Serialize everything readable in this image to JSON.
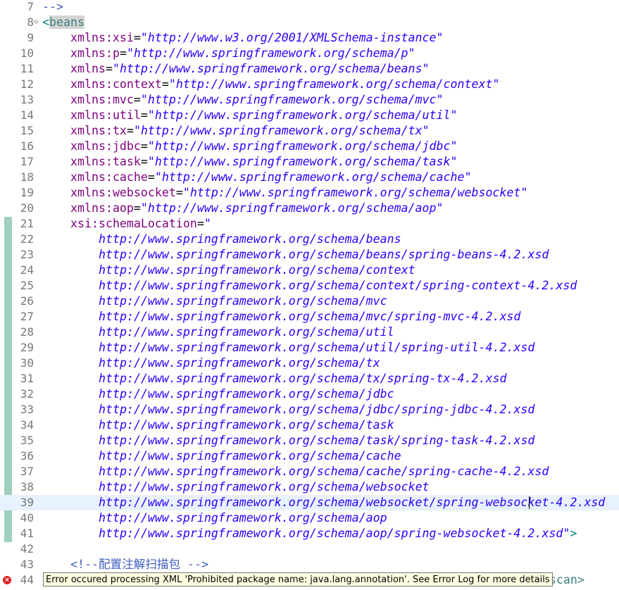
{
  "editor": {
    "lines": [
      {
        "num": "7",
        "parts": [
          {
            "t": "-->",
            "c": "comment"
          }
        ]
      },
      {
        "num": "8",
        "fold": "⊖",
        "parts": [
          {
            "t": "<",
            "c": "punct"
          },
          {
            "t": "beans",
            "c": "tag hl"
          }
        ]
      },
      {
        "num": "9",
        "indent": 1,
        "parts": [
          {
            "t": "xmlns:xsi",
            "c": "attr"
          },
          {
            "t": "=",
            "c": "plain"
          },
          {
            "t": "\"http://www.w3.org/2001/XMLSchema-instance\"",
            "c": "val"
          }
        ]
      },
      {
        "num": "10",
        "indent": 1,
        "parts": [
          {
            "t": "xmlns:p",
            "c": "attr"
          },
          {
            "t": "=",
            "c": "plain"
          },
          {
            "t": "\"http://www.springframework.org/schema/p\"",
            "c": "val"
          }
        ]
      },
      {
        "num": "11",
        "indent": 1,
        "parts": [
          {
            "t": "xmlns",
            "c": "attr"
          },
          {
            "t": "=",
            "c": "plain"
          },
          {
            "t": "\"http://www.springframework.org/schema/beans\"",
            "c": "val"
          }
        ]
      },
      {
        "num": "12",
        "indent": 1,
        "parts": [
          {
            "t": "xmlns:context",
            "c": "attr"
          },
          {
            "t": "=",
            "c": "plain"
          },
          {
            "t": "\"http://www.springframework.org/schema/context\"",
            "c": "val"
          }
        ]
      },
      {
        "num": "13",
        "indent": 1,
        "parts": [
          {
            "t": "xmlns:mvc",
            "c": "attr"
          },
          {
            "t": "=",
            "c": "plain"
          },
          {
            "t": "\"http://www.springframework.org/schema/mvc\"",
            "c": "val"
          }
        ]
      },
      {
        "num": "14",
        "indent": 1,
        "parts": [
          {
            "t": "xmlns:util",
            "c": "attr"
          },
          {
            "t": "=",
            "c": "plain"
          },
          {
            "t": "\"http://www.springframework.org/schema/util\"",
            "c": "val"
          }
        ]
      },
      {
        "num": "15",
        "indent": 1,
        "parts": [
          {
            "t": "xmlns:tx",
            "c": "attr"
          },
          {
            "t": "=",
            "c": "plain"
          },
          {
            "t": "\"http://www.springframework.org/schema/tx\"",
            "c": "val"
          }
        ]
      },
      {
        "num": "16",
        "indent": 1,
        "parts": [
          {
            "t": "xmlns:jdbc",
            "c": "attr"
          },
          {
            "t": "=",
            "c": "plain"
          },
          {
            "t": "\"http://www.springframework.org/schema/jdbc\"",
            "c": "val"
          }
        ]
      },
      {
        "num": "17",
        "indent": 1,
        "parts": [
          {
            "t": "xmlns:task",
            "c": "attr"
          },
          {
            "t": "=",
            "c": "plain"
          },
          {
            "t": "\"http://www.springframework.org/schema/task\"",
            "c": "val"
          }
        ]
      },
      {
        "num": "18",
        "indent": 1,
        "parts": [
          {
            "t": "xmlns:cache",
            "c": "attr"
          },
          {
            "t": "=",
            "c": "plain"
          },
          {
            "t": "\"http://www.springframework.org/schema/cache\"",
            "c": "val"
          }
        ]
      },
      {
        "num": "19",
        "indent": 1,
        "parts": [
          {
            "t": "xmlns:websocket",
            "c": "attr"
          },
          {
            "t": "=",
            "c": "plain"
          },
          {
            "t": "\"http://www.springframework.org/schema/websocket\"",
            "c": "val"
          }
        ]
      },
      {
        "num": "20",
        "indent": 1,
        "parts": [
          {
            "t": "xmlns:aop",
            "c": "attr"
          },
          {
            "t": "=",
            "c": "plain"
          },
          {
            "t": "\"http://www.springframework.org/schema/aop\"",
            "c": "val"
          }
        ]
      },
      {
        "num": "21",
        "indent": 1,
        "parts": [
          {
            "t": "xsi:schemaLocation",
            "c": "attr"
          },
          {
            "t": "=",
            "c": "plain"
          },
          {
            "t": "\"",
            "c": "val"
          }
        ]
      },
      {
        "num": "22",
        "indent": 2,
        "parts": [
          {
            "t": "http://www.springframework.org/schema/beans",
            "c": "val"
          }
        ]
      },
      {
        "num": "23",
        "indent": 2,
        "parts": [
          {
            "t": "http://www.springframework.org/schema/beans/spring-beans-4.2.xsd",
            "c": "val"
          }
        ]
      },
      {
        "num": "24",
        "indent": 2,
        "parts": [
          {
            "t": "http://www.springframework.org/schema/context",
            "c": "val"
          }
        ]
      },
      {
        "num": "25",
        "indent": 2,
        "parts": [
          {
            "t": "http://www.springframework.org/schema/context/spring-context-4.2.xsd",
            "c": "val"
          }
        ]
      },
      {
        "num": "26",
        "indent": 2,
        "parts": [
          {
            "t": "http://www.springframework.org/schema/mvc",
            "c": "val"
          }
        ]
      },
      {
        "num": "27",
        "indent": 2,
        "parts": [
          {
            "t": "http://www.springframework.org/schema/mvc/spring-mvc-4.2.xsd",
            "c": "val"
          }
        ]
      },
      {
        "num": "28",
        "indent": 2,
        "parts": [
          {
            "t": "http://www.springframework.org/schema/util",
            "c": "val"
          }
        ]
      },
      {
        "num": "29",
        "indent": 2,
        "parts": [
          {
            "t": "http://www.springframework.org/schema/util/spring-util-4.2.xsd",
            "c": "val"
          }
        ]
      },
      {
        "num": "30",
        "indent": 2,
        "parts": [
          {
            "t": "http://www.springframework.org/schema/tx",
            "c": "val"
          }
        ]
      },
      {
        "num": "31",
        "indent": 2,
        "parts": [
          {
            "t": "http://www.springframework.org/schema/tx/spring-tx-4.2.xsd",
            "c": "val"
          }
        ]
      },
      {
        "num": "32",
        "indent": 2,
        "parts": [
          {
            "t": "http://www.springframework.org/schema/jdbc",
            "c": "val"
          }
        ]
      },
      {
        "num": "33",
        "indent": 2,
        "parts": [
          {
            "t": "http://www.springframework.org/schema/jdbc/spring-jdbc-4.2.xsd",
            "c": "val"
          }
        ]
      },
      {
        "num": "34",
        "indent": 2,
        "parts": [
          {
            "t": "http://www.springframework.org/schema/task",
            "c": "val"
          }
        ]
      },
      {
        "num": "35",
        "indent": 2,
        "parts": [
          {
            "t": "http://www.springframework.org/schema/task/spring-task-4.2.xsd",
            "c": "val"
          }
        ]
      },
      {
        "num": "36",
        "indent": 2,
        "parts": [
          {
            "t": "http://www.springframework.org/schema/cache",
            "c": "val"
          }
        ]
      },
      {
        "num": "37",
        "indent": 2,
        "parts": [
          {
            "t": "http://www.springframework.org/schema/cache/spring-cache-4.2.xsd",
            "c": "val"
          }
        ]
      },
      {
        "num": "38",
        "indent": 2,
        "parts": [
          {
            "t": "http://www.springframework.org/schema/websocket",
            "c": "val"
          }
        ]
      },
      {
        "num": "39",
        "indent": 2,
        "current": true,
        "parts": [
          {
            "t": "http://www.springframework.org/schema/websocket/spring-websocket-4.2.xsd",
            "c": "val"
          }
        ]
      },
      {
        "num": "40",
        "indent": 2,
        "parts": [
          {
            "t": "http://www.springframework.org/schema/aop",
            "c": "val"
          }
        ]
      },
      {
        "num": "41",
        "indent": 2,
        "parts": [
          {
            "t": "http://www.springframework.org/schema/aop/spring-websocket-4.2.xsd\"",
            "c": "val"
          },
          {
            "t": ">",
            "c": "punct"
          }
        ]
      },
      {
        "num": "42",
        "parts": []
      },
      {
        "num": "43",
        "indent": 1,
        "parts": [
          {
            "t": "<!--配置注解扫描包 -->",
            "c": "comment"
          }
        ]
      },
      {
        "num": "44",
        "error": true,
        "parts": [
          {
            "t": "mponent-scan>",
            "c": "tag",
            "pad": 640
          }
        ]
      }
    ]
  },
  "tooltip": {
    "text": "Error occured processing XML 'Prohibited package name: java.lang.annotation'. See Error Log for more details"
  },
  "colors": {
    "tag": "#3f7f7f",
    "attribute": "#7f007f",
    "value": "#2a00ff",
    "comment": "#3f5fbf",
    "line_number": "#787878",
    "current_line": "#e8f2fe",
    "tooltip_bg": "#ffffe1"
  },
  "icons": [
    "fold-collapse-icon",
    "error-marker-icon"
  ]
}
